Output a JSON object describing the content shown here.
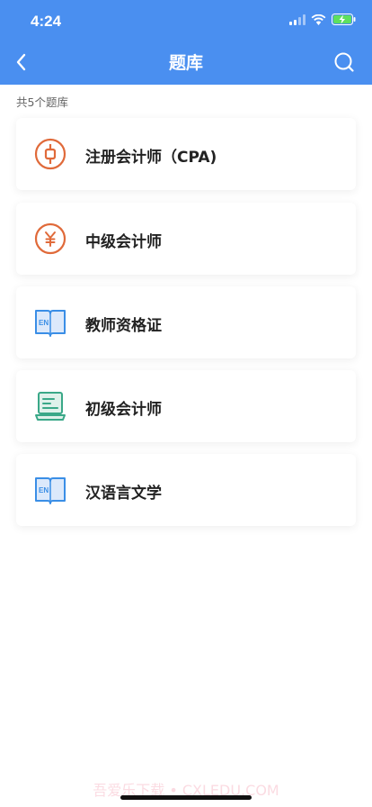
{
  "status": {
    "time": "4:24"
  },
  "nav": {
    "title": "题库"
  },
  "summary": {
    "count_label": "共5个题库"
  },
  "banks": [
    {
      "label": "注册会计师（CPA)",
      "icon": "cpa-coin-icon",
      "color": "#e06a3a"
    },
    {
      "label": "中级会计师",
      "icon": "yuan-coin-icon",
      "color": "#e06a3a"
    },
    {
      "label": "教师资格证",
      "icon": "en-book-icon",
      "color": "#3a8ee6"
    },
    {
      "label": "初级会计师",
      "icon": "laptop-doc-icon",
      "color": "#3aa888"
    },
    {
      "label": "汉语言文学",
      "icon": "en-book-icon",
      "color": "#3a8ee6"
    }
  ],
  "watermark": "吾爱乐下载 • CXLEDU.COM",
  "theme": {
    "primary": "#4a8ff0"
  }
}
